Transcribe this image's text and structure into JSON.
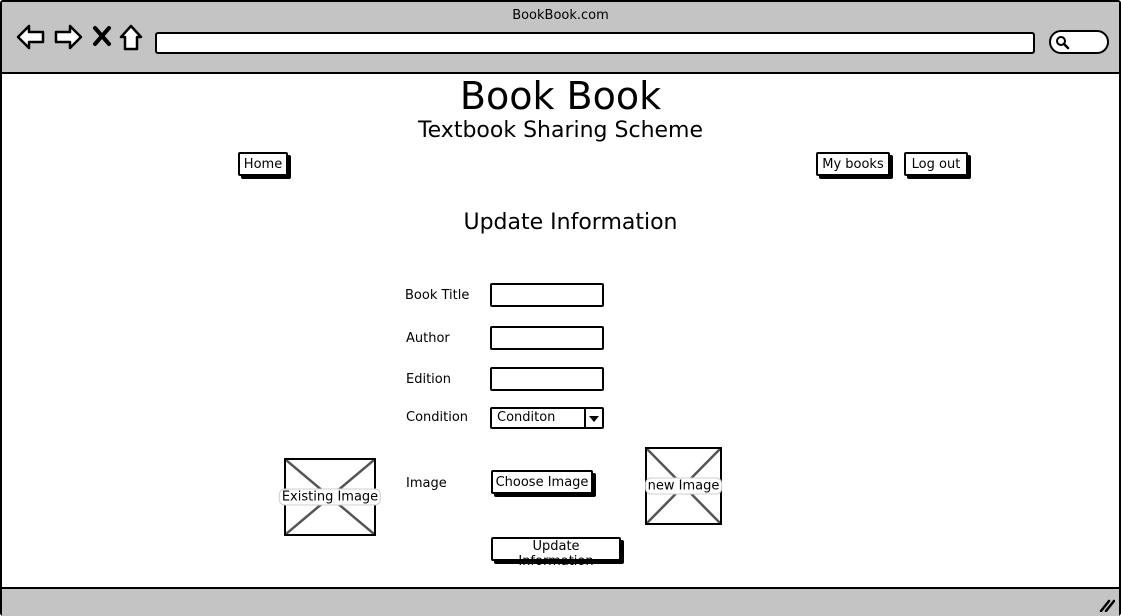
{
  "window": {
    "title": "BookBook.com",
    "address": "",
    "icons": [
      "back-arrow-icon",
      "forward-arrow-icon",
      "close-x-icon",
      "home-icon",
      "search-icon",
      "resize-grip-icon"
    ]
  },
  "site": {
    "title": "Book Book",
    "subtitle": "Textbook Sharing Scheme"
  },
  "nav": {
    "home": "Home",
    "my_books": "My books",
    "log_out": "Log out"
  },
  "page": {
    "heading": "Update Information"
  },
  "form": {
    "book_title_label": "Book Title",
    "book_title_value": "",
    "author_label": "Author",
    "author_value": "",
    "edition_label": "Edition",
    "edition_value": "",
    "condition_label": "Condition",
    "condition_selected": "Conditon",
    "image_label": "Image",
    "choose_image": "Choose Image",
    "submit": "Update Information"
  },
  "images": {
    "existing": "Existing Image",
    "new": "new Image"
  },
  "colors": {
    "chrome": "#c4c4c4",
    "background": "#ffffff",
    "ink": "#000000",
    "placeholder_lines": "#555555"
  }
}
